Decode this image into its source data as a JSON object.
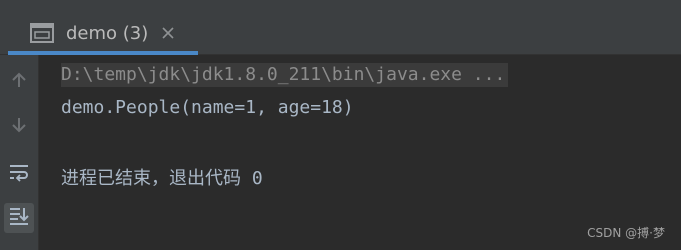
{
  "tab": {
    "label": "demo (3)",
    "icon": "console-window-icon",
    "close_icon": "close-icon",
    "accent_color": "#4a88c7"
  },
  "toolbar": {
    "buttons": [
      {
        "icon": "arrow-up-icon"
      },
      {
        "icon": "arrow-down-icon"
      },
      {
        "icon": "soft-wrap-icon"
      },
      {
        "icon": "scroll-to-end-icon",
        "active": true
      }
    ]
  },
  "console": {
    "command_line": "D:\\temp\\jdk\\jdk1.8.0_211\\bin\\java.exe ...",
    "output_line": "demo.People(name=1, age=18)",
    "exit_line": "进程已结束，退出代码 0"
  },
  "watermark": "CSDN @搏·梦"
}
